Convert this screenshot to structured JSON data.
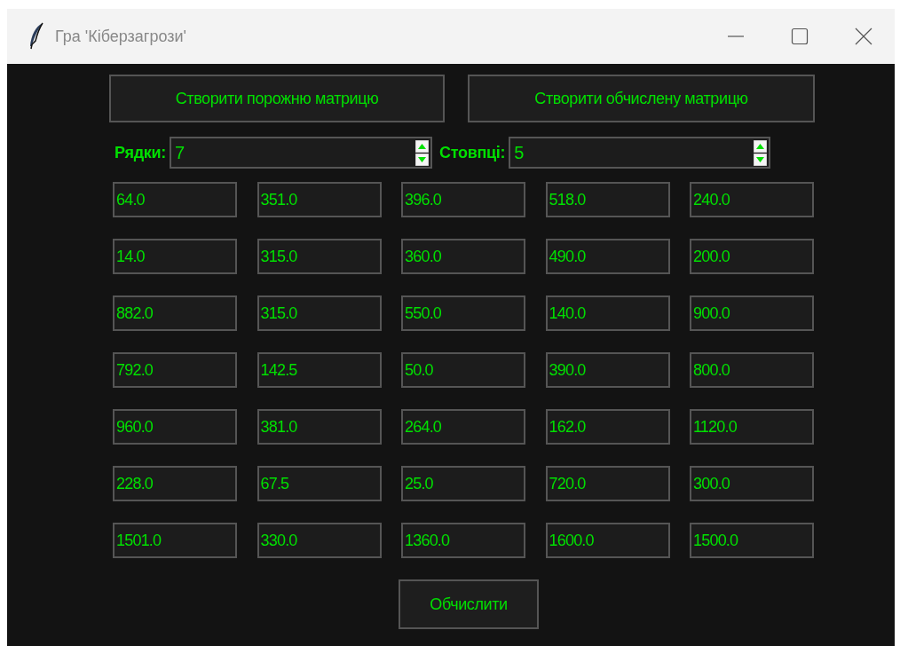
{
  "window": {
    "title": "Гра 'Кіберзагрози'"
  },
  "top_buttons": [
    "Створити порожню матрицю",
    "Створити обчислену матрицю"
  ],
  "spinboxes": [
    {
      "label": "Рядки:",
      "value": "7"
    },
    {
      "label": "Стовпці:",
      "value": "5"
    }
  ],
  "matrix": [
    [
      "64.0",
      "351.0",
      "396.0",
      "518.0",
      "240.0"
    ],
    [
      "14.0",
      "315.0",
      "360.0",
      "490.0",
      "200.0"
    ],
    [
      "882.0",
      "315.0",
      "550.0",
      "140.0",
      "900.0"
    ],
    [
      "792.0",
      "142.5",
      "50.0",
      "390.0",
      "800.0"
    ],
    [
      "960.0",
      "381.0",
      "264.0",
      "162.0",
      "1120.0"
    ],
    [
      "228.0",
      "67.5",
      "25.0",
      "720.0",
      "300.0"
    ],
    [
      "1501.0",
      "330.0",
      "1360.0",
      "1600.0",
      "1500.0"
    ]
  ],
  "action_button": "Обчислити"
}
